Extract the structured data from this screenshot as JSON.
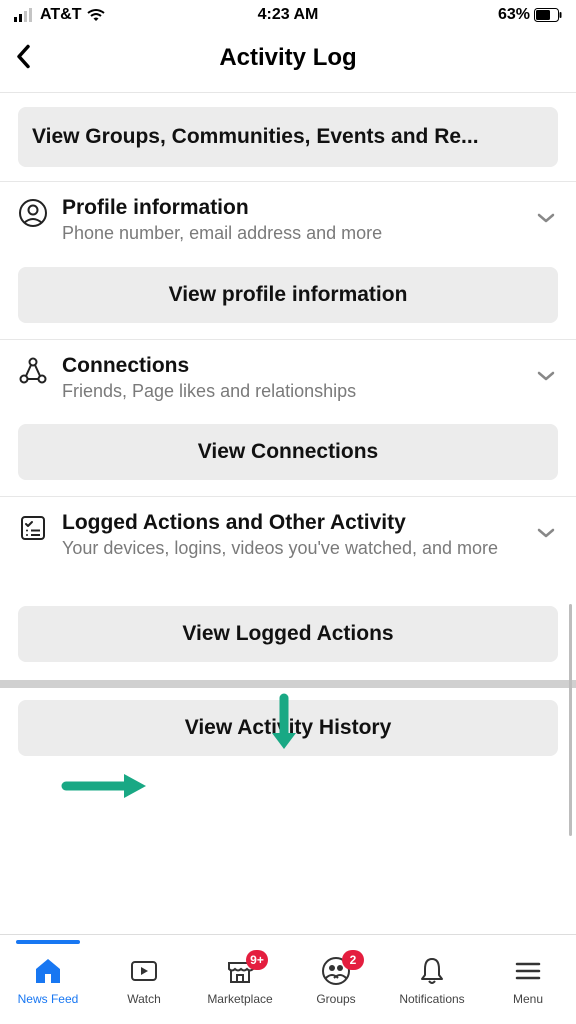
{
  "status": {
    "carrier": "AT&T",
    "time": "4:23 AM",
    "battery": "63%"
  },
  "header": {
    "title": "Activity Log"
  },
  "buttons": {
    "viewGroups": "View Groups, Communities, Events and Re...",
    "viewProfile": "View profile information",
    "viewConnections": "View Connections",
    "viewLoggedActions": "View Logged Actions",
    "viewActivityHistory": "View Activity History"
  },
  "sections": {
    "profile": {
      "title": "Profile information",
      "sub": "Phone number, email address and more"
    },
    "connections": {
      "title": "Connections",
      "sub": "Friends, Page likes and relationships"
    },
    "logged": {
      "title": "Logged Actions and Other Activity",
      "sub": "Your devices, logins, videos you've watched, and more"
    }
  },
  "tabs": {
    "news": "News Feed",
    "watch": "Watch",
    "marketplace": "Marketplace",
    "groups": "Groups",
    "notifications": "Notifications",
    "menu": "Menu",
    "marketplaceBadge": "9+",
    "groupsBadge": "2"
  }
}
